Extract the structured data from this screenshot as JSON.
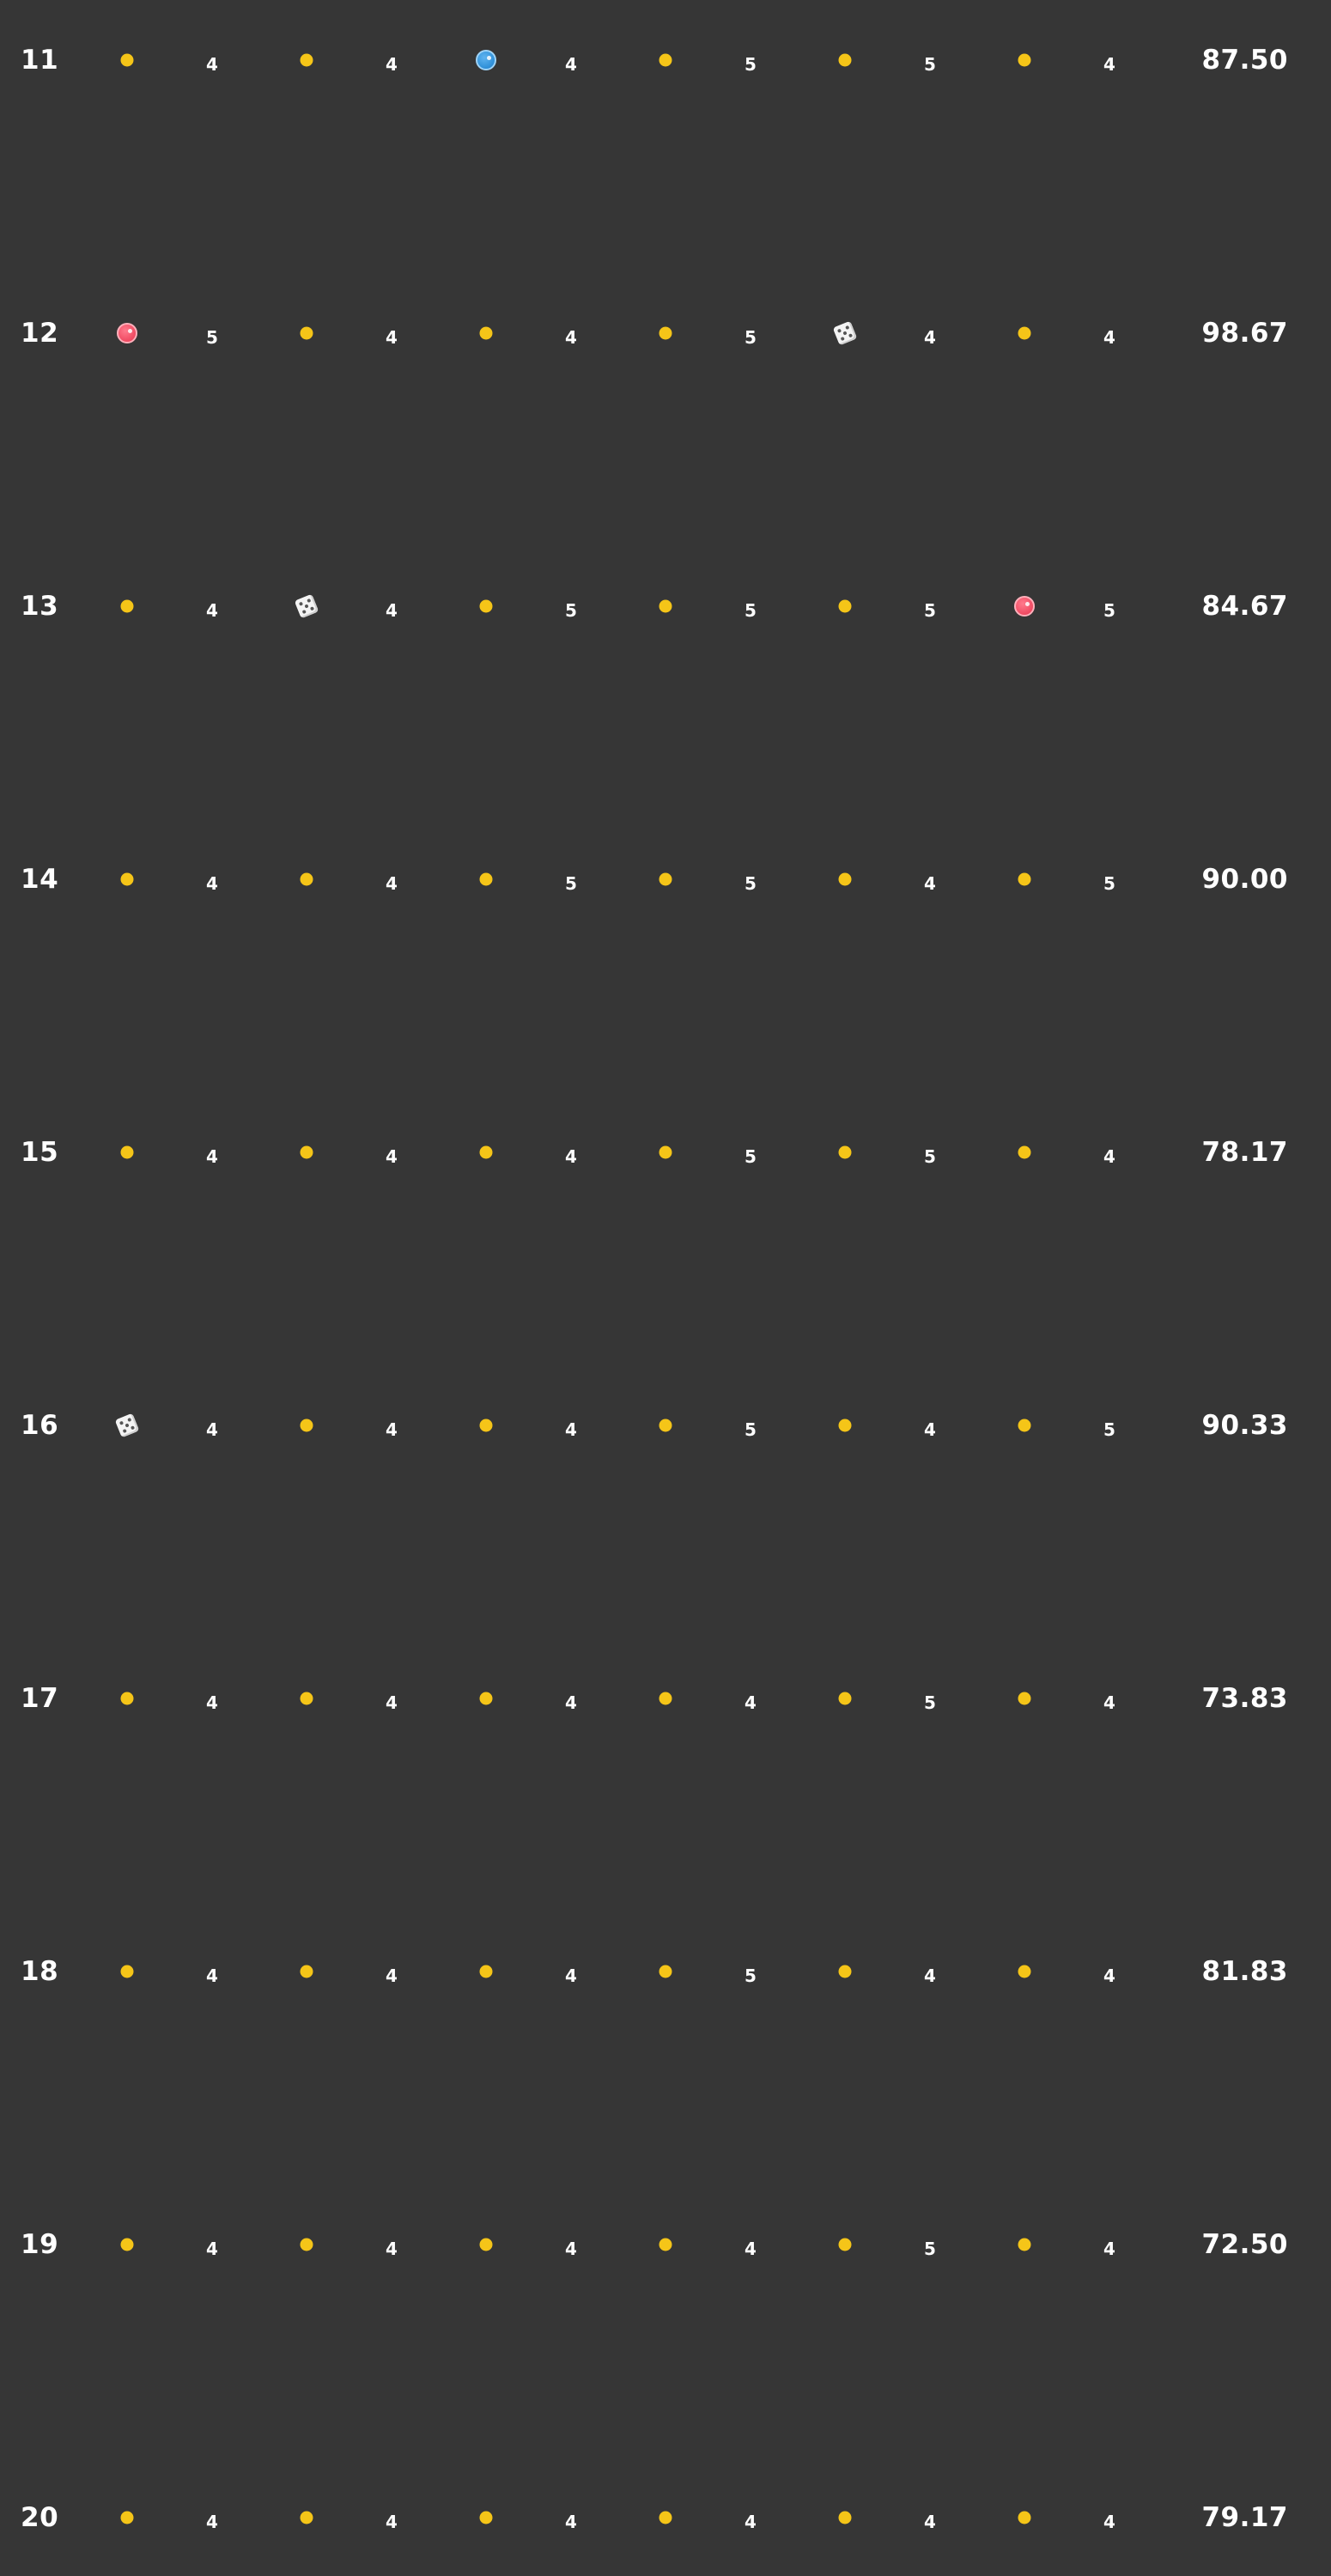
{
  "colors": {
    "background": "#363636",
    "text": "#ffffff",
    "dot": "#f5c518",
    "blue_ball": "#2e8fd8",
    "red_ball": "#f04a62",
    "die": "#f4f4f4"
  },
  "rows": [
    {
      "number": "11",
      "score": "87.50",
      "cells": [
        {
          "marker": "dot",
          "value": "4"
        },
        {
          "marker": "dot",
          "value": "4"
        },
        {
          "marker": "blue-ball",
          "value": "4"
        },
        {
          "marker": "dot",
          "value": "5"
        },
        {
          "marker": "dot",
          "value": "5"
        },
        {
          "marker": "dot",
          "value": "4"
        }
      ]
    },
    {
      "number": "12",
      "score": "98.67",
      "cells": [
        {
          "marker": "red-ball",
          "value": "5"
        },
        {
          "marker": "dot",
          "value": "4"
        },
        {
          "marker": "dot",
          "value": "4"
        },
        {
          "marker": "dot",
          "value": "5"
        },
        {
          "marker": "die",
          "value": "4"
        },
        {
          "marker": "dot",
          "value": "4"
        }
      ]
    },
    {
      "number": "13",
      "score": "84.67",
      "cells": [
        {
          "marker": "dot",
          "value": "4"
        },
        {
          "marker": "die",
          "value": "4"
        },
        {
          "marker": "dot",
          "value": "5"
        },
        {
          "marker": "dot",
          "value": "5"
        },
        {
          "marker": "dot",
          "value": "5"
        },
        {
          "marker": "red-ball",
          "value": "5"
        }
      ]
    },
    {
      "number": "14",
      "score": "90.00",
      "cells": [
        {
          "marker": "dot",
          "value": "4"
        },
        {
          "marker": "dot",
          "value": "4"
        },
        {
          "marker": "dot",
          "value": "5"
        },
        {
          "marker": "dot",
          "value": "5"
        },
        {
          "marker": "dot",
          "value": "4"
        },
        {
          "marker": "dot",
          "value": "5"
        }
      ]
    },
    {
      "number": "15",
      "score": "78.17",
      "cells": [
        {
          "marker": "dot",
          "value": "4"
        },
        {
          "marker": "dot",
          "value": "4"
        },
        {
          "marker": "dot",
          "value": "4"
        },
        {
          "marker": "dot",
          "value": "5"
        },
        {
          "marker": "dot",
          "value": "5"
        },
        {
          "marker": "dot",
          "value": "4"
        }
      ]
    },
    {
      "number": "16",
      "score": "90.33",
      "cells": [
        {
          "marker": "die",
          "value": "4"
        },
        {
          "marker": "dot",
          "value": "4"
        },
        {
          "marker": "dot",
          "value": "4"
        },
        {
          "marker": "dot",
          "value": "5"
        },
        {
          "marker": "dot",
          "value": "4"
        },
        {
          "marker": "dot",
          "value": "5"
        }
      ]
    },
    {
      "number": "17",
      "score": "73.83",
      "cells": [
        {
          "marker": "dot",
          "value": "4"
        },
        {
          "marker": "dot",
          "value": "4"
        },
        {
          "marker": "dot",
          "value": "4"
        },
        {
          "marker": "dot",
          "value": "4"
        },
        {
          "marker": "dot",
          "value": "5"
        },
        {
          "marker": "dot",
          "value": "4"
        }
      ]
    },
    {
      "number": "18",
      "score": "81.83",
      "cells": [
        {
          "marker": "dot",
          "value": "4"
        },
        {
          "marker": "dot",
          "value": "4"
        },
        {
          "marker": "dot",
          "value": "4"
        },
        {
          "marker": "dot",
          "value": "5"
        },
        {
          "marker": "dot",
          "value": "4"
        },
        {
          "marker": "dot",
          "value": "4"
        }
      ]
    },
    {
      "number": "19",
      "score": "72.50",
      "cells": [
        {
          "marker": "dot",
          "value": "4"
        },
        {
          "marker": "dot",
          "value": "4"
        },
        {
          "marker": "dot",
          "value": "4"
        },
        {
          "marker": "dot",
          "value": "4"
        },
        {
          "marker": "dot",
          "value": "5"
        },
        {
          "marker": "dot",
          "value": "4"
        }
      ]
    },
    {
      "number": "20",
      "score": "79.17",
      "cells": [
        {
          "marker": "dot",
          "value": "4"
        },
        {
          "marker": "dot",
          "value": "4"
        },
        {
          "marker": "dot",
          "value": "4"
        },
        {
          "marker": "dot",
          "value": "4"
        },
        {
          "marker": "dot",
          "value": "4"
        },
        {
          "marker": "dot",
          "value": "4"
        }
      ]
    }
  ]
}
